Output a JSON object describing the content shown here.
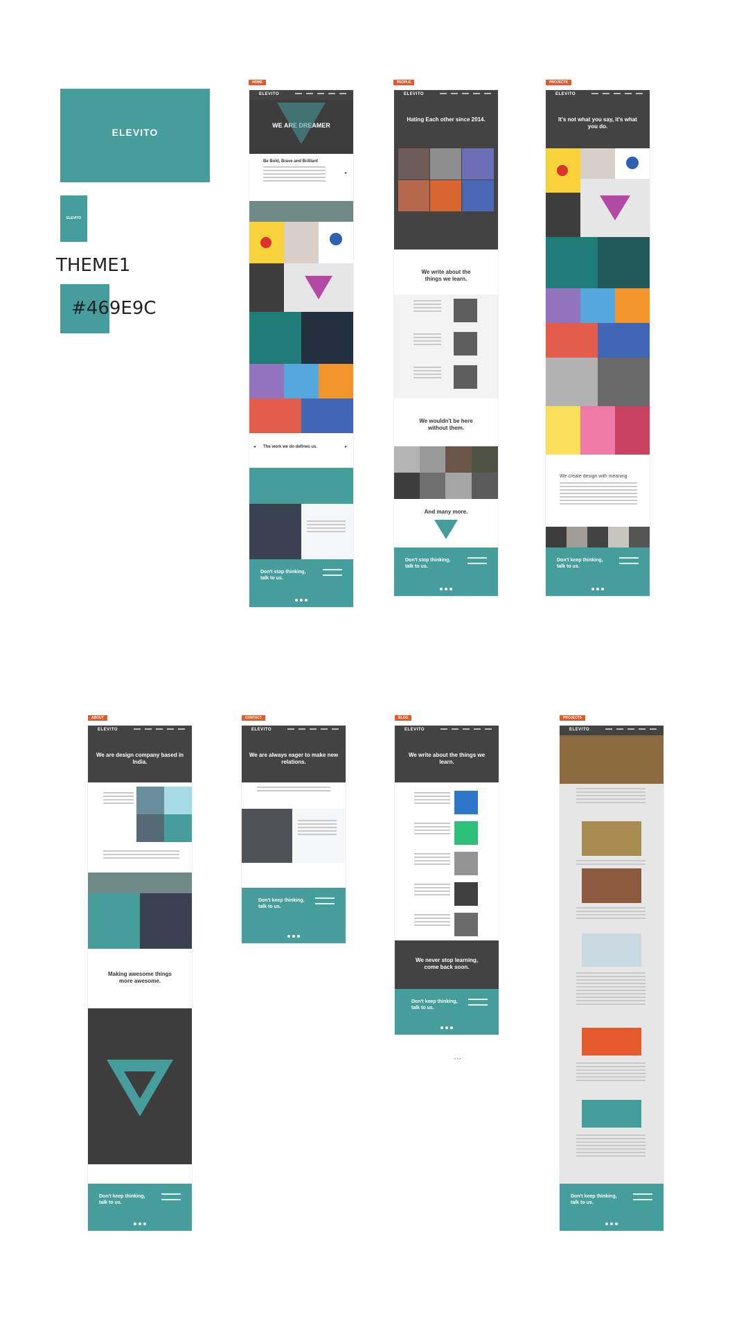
{
  "theme": {
    "logo": "ELEVITO",
    "label": "THEME1",
    "hex": "#469E9C",
    "hex_text": "#469E9C",
    "colors": {
      "teal": "#469E9C",
      "dark": "#434343",
      "orange": "#E55A2B"
    }
  },
  "home": {
    "tag": "HOME",
    "hero": "WE ARE DREAMER",
    "intro_title": "Be Bold, Brave and Brilliant",
    "work_title": "The work we do defines us.",
    "footer": "Don't stop thinking, talk to us."
  },
  "people": {
    "tag": "PEOPLE",
    "hero": "Hating Each other since 2014.",
    "write_title": "We write about the things we learn.",
    "team_title": "We wouldn't be here without them.",
    "more_title": "And many more.",
    "footer": "Don't stop thinking, talk to us."
  },
  "projects": {
    "tag": "PROJECTS",
    "hero": "It's not what you say, it's what you do.",
    "meaning_title": "We create design with meaning",
    "footer": "Don't keep thinking, talk to us."
  },
  "about": {
    "tag": "ABOUT",
    "hero": "We are design company based in India.",
    "awesome_title": "Making awesome things more awesome.",
    "footer": "Don't keep thinking, talk to us."
  },
  "contact": {
    "tag": "CONTACT",
    "hero": "We are always eager to make new relations.",
    "footer": "Don't keep thinking, talk to us."
  },
  "blog": {
    "tag": "BLOG",
    "hero": "We write about the things we learn.",
    "never_stop": "We never stop learning, come back soon.",
    "footer": "Don't keep thinking, talk to us."
  },
  "article": {
    "tag": "PROJECTS",
    "footer": "Don't keep thinking, talk to us."
  }
}
